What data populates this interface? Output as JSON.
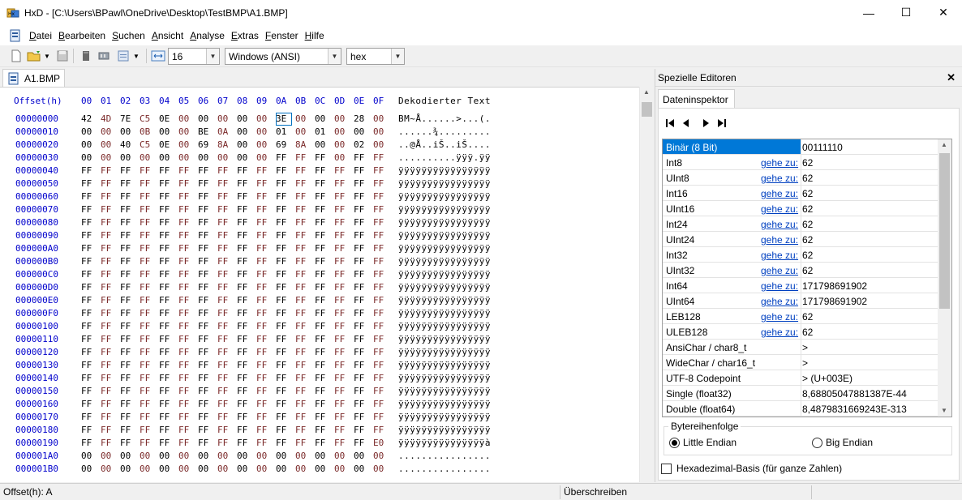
{
  "window": {
    "title": "HxD - [C:\\Users\\BPawl\\OneDrive\\Desktop\\TestBMP\\A1.BMP]",
    "minimize": "—",
    "maximize": "☐",
    "close": "✕"
  },
  "menu": [
    "Datei",
    "Bearbeiten",
    "Suchen",
    "Ansicht",
    "Analyse",
    "Extras",
    "Fenster",
    "Hilfe"
  ],
  "toolbar": {
    "bytes_per_row": "16",
    "charset": "Windows (ANSI)",
    "number_base": "hex"
  },
  "document_tab": "A1.BMP",
  "hex": {
    "header_offset": "Offset(h)",
    "header_cols": [
      "00",
      "01",
      "02",
      "03",
      "04",
      "05",
      "06",
      "07",
      "08",
      "09",
      "0A",
      "0B",
      "0C",
      "0D",
      "0E",
      "0F"
    ],
    "header_text": "Dekodierter Text",
    "selected_row": 0,
    "selected_col": 10,
    "rows": [
      {
        "off": "00000000",
        "bytes": [
          "42",
          "4D",
          "7E",
          "C5",
          "0E",
          "00",
          "00",
          "00",
          "00",
          "00",
          "3E",
          "00",
          "00",
          "00",
          "28",
          "00"
        ],
        "text": "BM~Å......>...(."
      },
      {
        "off": "00000010",
        "bytes": [
          "00",
          "00",
          "00",
          "0B",
          "00",
          "00",
          "BE",
          "0A",
          "00",
          "00",
          "01",
          "00",
          "01",
          "00",
          "00",
          "00"
        ],
        "text": "......¾........."
      },
      {
        "off": "00000020",
        "bytes": [
          "00",
          "00",
          "40",
          "C5",
          "0E",
          "00",
          "69",
          "8A",
          "00",
          "00",
          "69",
          "8A",
          "00",
          "00",
          "02",
          "00"
        ],
        "text": "..@Å..iŠ..iŠ...."
      },
      {
        "off": "00000030",
        "bytes": [
          "00",
          "00",
          "00",
          "00",
          "00",
          "00",
          "00",
          "00",
          "00",
          "00",
          "FF",
          "FF",
          "FF",
          "00",
          "FF",
          "FF"
        ],
        "text": "..........ÿÿÿ.ÿÿ"
      },
      {
        "off": "00000040",
        "bytes": [
          "FF",
          "FF",
          "FF",
          "FF",
          "FF",
          "FF",
          "FF",
          "FF",
          "FF",
          "FF",
          "FF",
          "FF",
          "FF",
          "FF",
          "FF",
          "FF"
        ],
        "text": "ÿÿÿÿÿÿÿÿÿÿÿÿÿÿÿÿ"
      },
      {
        "off": "00000050",
        "bytes": [
          "FF",
          "FF",
          "FF",
          "FF",
          "FF",
          "FF",
          "FF",
          "FF",
          "FF",
          "FF",
          "FF",
          "FF",
          "FF",
          "FF",
          "FF",
          "FF"
        ],
        "text": "ÿÿÿÿÿÿÿÿÿÿÿÿÿÿÿÿ"
      },
      {
        "off": "00000060",
        "bytes": [
          "FF",
          "FF",
          "FF",
          "FF",
          "FF",
          "FF",
          "FF",
          "FF",
          "FF",
          "FF",
          "FF",
          "FF",
          "FF",
          "FF",
          "FF",
          "FF"
        ],
        "text": "ÿÿÿÿÿÿÿÿÿÿÿÿÿÿÿÿ"
      },
      {
        "off": "00000070",
        "bytes": [
          "FF",
          "FF",
          "FF",
          "FF",
          "FF",
          "FF",
          "FF",
          "FF",
          "FF",
          "FF",
          "FF",
          "FF",
          "FF",
          "FF",
          "FF",
          "FF"
        ],
        "text": "ÿÿÿÿÿÿÿÿÿÿÿÿÿÿÿÿ"
      },
      {
        "off": "00000080",
        "bytes": [
          "FF",
          "FF",
          "FF",
          "FF",
          "FF",
          "FF",
          "FF",
          "FF",
          "FF",
          "FF",
          "FF",
          "FF",
          "FF",
          "FF",
          "FF",
          "FF"
        ],
        "text": "ÿÿÿÿÿÿÿÿÿÿÿÿÿÿÿÿ"
      },
      {
        "off": "00000090",
        "bytes": [
          "FF",
          "FF",
          "FF",
          "FF",
          "FF",
          "FF",
          "FF",
          "FF",
          "FF",
          "FF",
          "FF",
          "FF",
          "FF",
          "FF",
          "FF",
          "FF"
        ],
        "text": "ÿÿÿÿÿÿÿÿÿÿÿÿÿÿÿÿ"
      },
      {
        "off": "000000A0",
        "bytes": [
          "FF",
          "FF",
          "FF",
          "FF",
          "FF",
          "FF",
          "FF",
          "FF",
          "FF",
          "FF",
          "FF",
          "FF",
          "FF",
          "FF",
          "FF",
          "FF"
        ],
        "text": "ÿÿÿÿÿÿÿÿÿÿÿÿÿÿÿÿ"
      },
      {
        "off": "000000B0",
        "bytes": [
          "FF",
          "FF",
          "FF",
          "FF",
          "FF",
          "FF",
          "FF",
          "FF",
          "FF",
          "FF",
          "FF",
          "FF",
          "FF",
          "FF",
          "FF",
          "FF"
        ],
        "text": "ÿÿÿÿÿÿÿÿÿÿÿÿÿÿÿÿ"
      },
      {
        "off": "000000C0",
        "bytes": [
          "FF",
          "FF",
          "FF",
          "FF",
          "FF",
          "FF",
          "FF",
          "FF",
          "FF",
          "FF",
          "FF",
          "FF",
          "FF",
          "FF",
          "FF",
          "FF"
        ],
        "text": "ÿÿÿÿÿÿÿÿÿÿÿÿÿÿÿÿ"
      },
      {
        "off": "000000D0",
        "bytes": [
          "FF",
          "FF",
          "FF",
          "FF",
          "FF",
          "FF",
          "FF",
          "FF",
          "FF",
          "FF",
          "FF",
          "FF",
          "FF",
          "FF",
          "FF",
          "FF"
        ],
        "text": "ÿÿÿÿÿÿÿÿÿÿÿÿÿÿÿÿ"
      },
      {
        "off": "000000E0",
        "bytes": [
          "FF",
          "FF",
          "FF",
          "FF",
          "FF",
          "FF",
          "FF",
          "FF",
          "FF",
          "FF",
          "FF",
          "FF",
          "FF",
          "FF",
          "FF",
          "FF"
        ],
        "text": "ÿÿÿÿÿÿÿÿÿÿÿÿÿÿÿÿ"
      },
      {
        "off": "000000F0",
        "bytes": [
          "FF",
          "FF",
          "FF",
          "FF",
          "FF",
          "FF",
          "FF",
          "FF",
          "FF",
          "FF",
          "FF",
          "FF",
          "FF",
          "FF",
          "FF",
          "FF"
        ],
        "text": "ÿÿÿÿÿÿÿÿÿÿÿÿÿÿÿÿ"
      },
      {
        "off": "00000100",
        "bytes": [
          "FF",
          "FF",
          "FF",
          "FF",
          "FF",
          "FF",
          "FF",
          "FF",
          "FF",
          "FF",
          "FF",
          "FF",
          "FF",
          "FF",
          "FF",
          "FF"
        ],
        "text": "ÿÿÿÿÿÿÿÿÿÿÿÿÿÿÿÿ"
      },
      {
        "off": "00000110",
        "bytes": [
          "FF",
          "FF",
          "FF",
          "FF",
          "FF",
          "FF",
          "FF",
          "FF",
          "FF",
          "FF",
          "FF",
          "FF",
          "FF",
          "FF",
          "FF",
          "FF"
        ],
        "text": "ÿÿÿÿÿÿÿÿÿÿÿÿÿÿÿÿ"
      },
      {
        "off": "00000120",
        "bytes": [
          "FF",
          "FF",
          "FF",
          "FF",
          "FF",
          "FF",
          "FF",
          "FF",
          "FF",
          "FF",
          "FF",
          "FF",
          "FF",
          "FF",
          "FF",
          "FF"
        ],
        "text": "ÿÿÿÿÿÿÿÿÿÿÿÿÿÿÿÿ"
      },
      {
        "off": "00000130",
        "bytes": [
          "FF",
          "FF",
          "FF",
          "FF",
          "FF",
          "FF",
          "FF",
          "FF",
          "FF",
          "FF",
          "FF",
          "FF",
          "FF",
          "FF",
          "FF",
          "FF"
        ],
        "text": "ÿÿÿÿÿÿÿÿÿÿÿÿÿÿÿÿ"
      },
      {
        "off": "00000140",
        "bytes": [
          "FF",
          "FF",
          "FF",
          "FF",
          "FF",
          "FF",
          "FF",
          "FF",
          "FF",
          "FF",
          "FF",
          "FF",
          "FF",
          "FF",
          "FF",
          "FF"
        ],
        "text": "ÿÿÿÿÿÿÿÿÿÿÿÿÿÿÿÿ"
      },
      {
        "off": "00000150",
        "bytes": [
          "FF",
          "FF",
          "FF",
          "FF",
          "FF",
          "FF",
          "FF",
          "FF",
          "FF",
          "FF",
          "FF",
          "FF",
          "FF",
          "FF",
          "FF",
          "FF"
        ],
        "text": "ÿÿÿÿÿÿÿÿÿÿÿÿÿÿÿÿ"
      },
      {
        "off": "00000160",
        "bytes": [
          "FF",
          "FF",
          "FF",
          "FF",
          "FF",
          "FF",
          "FF",
          "FF",
          "FF",
          "FF",
          "FF",
          "FF",
          "FF",
          "FF",
          "FF",
          "FF"
        ],
        "text": "ÿÿÿÿÿÿÿÿÿÿÿÿÿÿÿÿ"
      },
      {
        "off": "00000170",
        "bytes": [
          "FF",
          "FF",
          "FF",
          "FF",
          "FF",
          "FF",
          "FF",
          "FF",
          "FF",
          "FF",
          "FF",
          "FF",
          "FF",
          "FF",
          "FF",
          "FF"
        ],
        "text": "ÿÿÿÿÿÿÿÿÿÿÿÿÿÿÿÿ"
      },
      {
        "off": "00000180",
        "bytes": [
          "FF",
          "FF",
          "FF",
          "FF",
          "FF",
          "FF",
          "FF",
          "FF",
          "FF",
          "FF",
          "FF",
          "FF",
          "FF",
          "FF",
          "FF",
          "FF"
        ],
        "text": "ÿÿÿÿÿÿÿÿÿÿÿÿÿÿÿÿ"
      },
      {
        "off": "00000190",
        "bytes": [
          "FF",
          "FF",
          "FF",
          "FF",
          "FF",
          "FF",
          "FF",
          "FF",
          "FF",
          "FF",
          "FF",
          "FF",
          "FF",
          "FF",
          "FF",
          "E0"
        ],
        "text": "ÿÿÿÿÿÿÿÿÿÿÿÿÿÿÿà"
      },
      {
        "off": "000001A0",
        "bytes": [
          "00",
          "00",
          "00",
          "00",
          "00",
          "00",
          "00",
          "00",
          "00",
          "00",
          "00",
          "00",
          "00",
          "00",
          "00",
          "00"
        ],
        "text": "................"
      },
      {
        "off": "000001B0",
        "bytes": [
          "00",
          "00",
          "00",
          "00",
          "00",
          "00",
          "00",
          "00",
          "00",
          "00",
          "00",
          "00",
          "00",
          "00",
          "00",
          "00"
        ],
        "text": "................"
      }
    ]
  },
  "right_panel": {
    "title": "Spezielle Editoren",
    "close": "✕",
    "tab": "Dateninspektor",
    "nav": [
      "first",
      "prev",
      "next",
      "last"
    ],
    "goto_label": "gehe zu:",
    "rows": [
      {
        "name": "Binär (8 Bit)",
        "goto": false,
        "value": "00111110",
        "selected": true
      },
      {
        "name": "Int8",
        "goto": true,
        "value": "62"
      },
      {
        "name": "UInt8",
        "goto": true,
        "value": "62"
      },
      {
        "name": "Int16",
        "goto": true,
        "value": "62"
      },
      {
        "name": "UInt16",
        "goto": true,
        "value": "62"
      },
      {
        "name": "Int24",
        "goto": true,
        "value": "62"
      },
      {
        "name": "UInt24",
        "goto": true,
        "value": "62"
      },
      {
        "name": "Int32",
        "goto": true,
        "value": "62"
      },
      {
        "name": "UInt32",
        "goto": true,
        "value": "62"
      },
      {
        "name": "Int64",
        "goto": true,
        "value": "171798691902"
      },
      {
        "name": "UInt64",
        "goto": true,
        "value": "171798691902"
      },
      {
        "name": "LEB128",
        "goto": true,
        "value": "62"
      },
      {
        "name": "ULEB128",
        "goto": true,
        "value": "62"
      },
      {
        "name": "AnsiChar / char8_t",
        "goto": false,
        "value": ">"
      },
      {
        "name": "WideChar / char16_t",
        "goto": false,
        "value": ">"
      },
      {
        "name": "UTF-8 Codepoint",
        "goto": false,
        "value": "> (U+003E)"
      },
      {
        "name": "Single (float32)",
        "goto": false,
        "value": "8,68805047881387E-44"
      },
      {
        "name": "Double (float64)",
        "goto": false,
        "value": "8,4879831669243E-313"
      }
    ],
    "byte_order": {
      "label": "Bytereihenfolge",
      "little": "Little Endian",
      "big": "Big Endian",
      "selected": "little"
    },
    "hex_base_label": "Hexadezimal-Basis (für ganze Zahlen)"
  },
  "status": {
    "offset": "Offset(h): A",
    "mode": "Überschreiben"
  },
  "colors": {
    "offset_blue": "#0000cc",
    "odd_byte": "#7b2a2a",
    "selection": "#0078d7",
    "link": "#0040c0"
  }
}
